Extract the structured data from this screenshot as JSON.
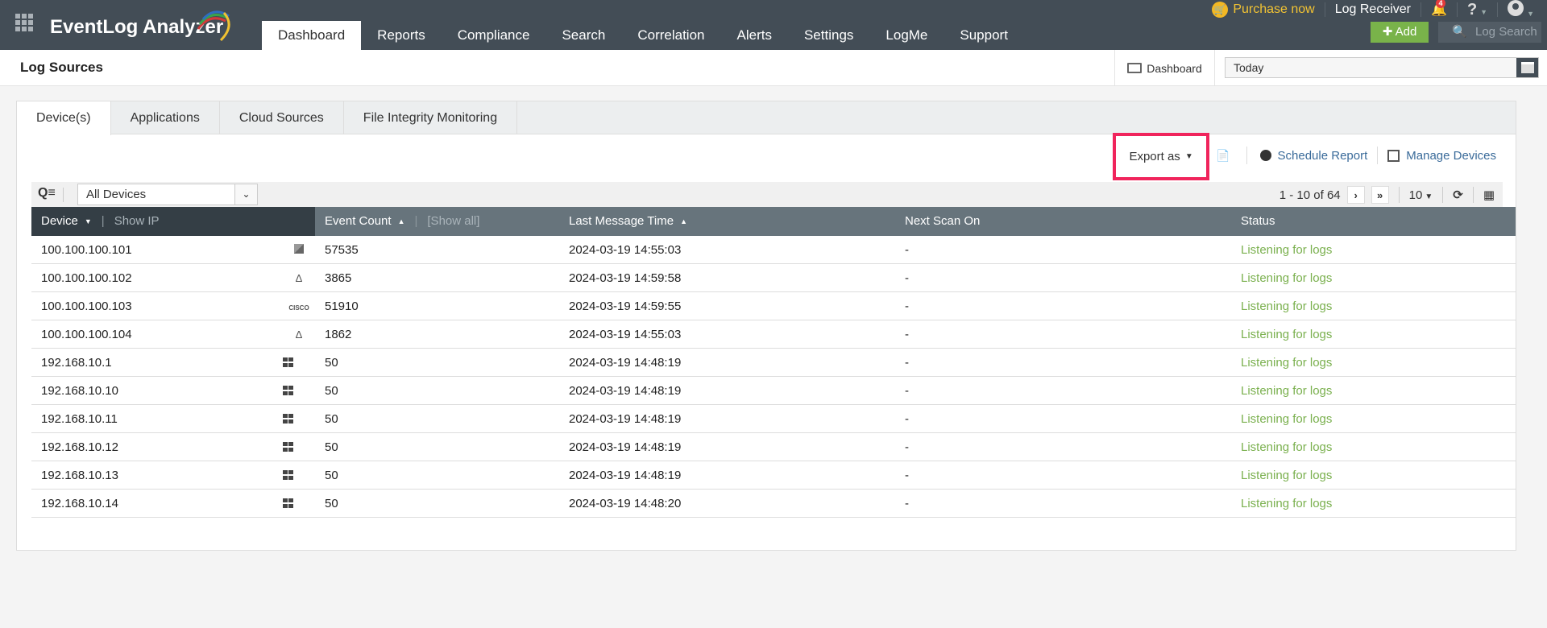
{
  "app": {
    "name": "EventLog Analyzer"
  },
  "nav": {
    "items": [
      {
        "label": "Dashboard",
        "active": true
      },
      {
        "label": "Reports"
      },
      {
        "label": "Compliance"
      },
      {
        "label": "Search"
      },
      {
        "label": "Correlation"
      },
      {
        "label": "Alerts"
      },
      {
        "label": "Settings"
      },
      {
        "label": "LogMe"
      },
      {
        "label": "Support"
      }
    ]
  },
  "topright": {
    "purchase": "Purchase now",
    "log_receiver": "Log Receiver",
    "notification_count": "4",
    "help": "?",
    "add_label": "Add",
    "log_search_placeholder": "Log Search"
  },
  "subbar": {
    "title": "Log Sources",
    "dashboard_link": "Dashboard",
    "date_range": "Today"
  },
  "tabs": [
    {
      "label": "Device(s)",
      "active": true
    },
    {
      "label": "Applications"
    },
    {
      "label": "Cloud Sources"
    },
    {
      "label": "File Integrity Monitoring"
    }
  ],
  "actions": {
    "export": "Export as",
    "schedule": "Schedule Report",
    "manage": "Manage Devices"
  },
  "filter": {
    "selected": "All Devices",
    "pagination": "1 - 10 of 64",
    "page_size": "10"
  },
  "table": {
    "headers": {
      "device": "Device",
      "show_ip": "Show IP",
      "event_count": "Event Count",
      "show_all": "[Show all]",
      "last_message": "Last Message Time",
      "next_scan": "Next Scan On",
      "status": "Status"
    },
    "rows": [
      {
        "device": "100.100.100.101",
        "os": "network-device-icon",
        "count": "57535",
        "last": "2024-03-19 14:55:03",
        "next": "-",
        "status": "Listening for logs"
      },
      {
        "device": "100.100.100.102",
        "os": "linux-icon",
        "count": "3865",
        "last": "2024-03-19 14:59:58",
        "next": "-",
        "status": "Listening for logs"
      },
      {
        "device": "100.100.100.103",
        "os": "cisco-icon",
        "count": "51910",
        "last": "2024-03-19 14:59:55",
        "next": "-",
        "status": "Listening for logs"
      },
      {
        "device": "100.100.100.104",
        "os": "linux-icon",
        "count": "1862",
        "last": "2024-03-19 14:55:03",
        "next": "-",
        "status": "Listening for logs"
      },
      {
        "device": "192.168.10.1",
        "os": "windows-icon",
        "count": "50",
        "last": "2024-03-19 14:48:19",
        "next": "-",
        "status": "Listening for logs"
      },
      {
        "device": "192.168.10.10",
        "os": "windows-icon",
        "count": "50",
        "last": "2024-03-19 14:48:19",
        "next": "-",
        "status": "Listening for logs"
      },
      {
        "device": "192.168.10.11",
        "os": "windows-icon",
        "count": "50",
        "last": "2024-03-19 14:48:19",
        "next": "-",
        "status": "Listening for logs"
      },
      {
        "device": "192.168.10.12",
        "os": "windows-icon",
        "count": "50",
        "last": "2024-03-19 14:48:19",
        "next": "-",
        "status": "Listening for logs"
      },
      {
        "device": "192.168.10.13",
        "os": "windows-icon",
        "count": "50",
        "last": "2024-03-19 14:48:19",
        "next": "-",
        "status": "Listening for logs"
      },
      {
        "device": "192.168.10.14",
        "os": "windows-icon",
        "count": "50",
        "last": "2024-03-19 14:48:20",
        "next": "-",
        "status": "Listening for logs"
      }
    ]
  },
  "colors": {
    "status_ok": "#7ab04e",
    "highlight": "#f0245c",
    "add": "#79b34a",
    "topbar": "#434d56"
  }
}
